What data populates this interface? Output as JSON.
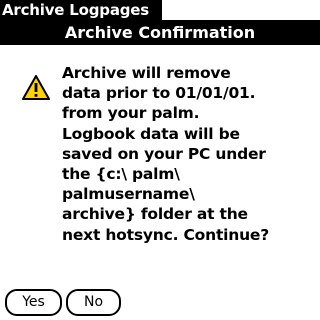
{
  "app": {
    "title": "Archive Logpages"
  },
  "dialog": {
    "title": "Archive Confirmation",
    "icon": "warning-icon",
    "message": "Archive will remove\ndata prior to 01/01/01.\nfrom your palm.\nLogbook data will be\nsaved on your PC under\nthe {c:\\ palm\\\npalmusername\\\narchive} folder at the\nnext hotsync. Continue?",
    "buttons": {
      "yes_label": "Yes",
      "no_label": "No"
    }
  },
  "colors": {
    "title_bar": "#000000",
    "title_text": "#ffffff",
    "background": "#ffffff",
    "warning_fill": "#ffd200"
  }
}
